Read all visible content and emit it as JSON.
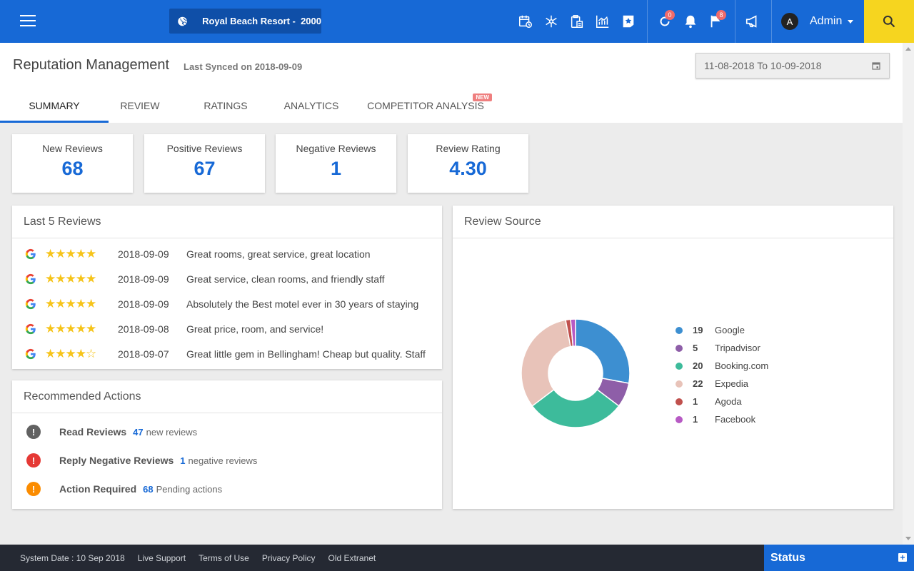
{
  "topbar": {
    "property_name": "Royal Beach Resort -  2000",
    "badges": {
      "refresh": "0",
      "flag": "8"
    },
    "admin_initial": "A",
    "admin_name": "Admin"
  },
  "header": {
    "title": "Reputation Management",
    "last_synced": "Last Synced on 2018-09-09",
    "date_range": "11-08-2018 To 10-09-2018",
    "tabs": [
      "SUMMARY",
      "REVIEW",
      "RATINGS",
      "ANALYTICS",
      "COMPETITOR ANALYSIS"
    ],
    "new_badge": "NEW"
  },
  "stats": [
    {
      "label": "New Reviews",
      "value": "68"
    },
    {
      "label": "Positive Reviews",
      "value": "67"
    },
    {
      "label": "Negative Reviews",
      "value": "1"
    },
    {
      "label": "Review Rating",
      "value": "4.30"
    }
  ],
  "last_reviews": {
    "title": "Last 5 Reviews",
    "rows": [
      {
        "stars": "★★★★★",
        "rating": 5,
        "date": "2018-09-09",
        "text": "Great rooms, great service, great location"
      },
      {
        "stars": "★★★★★",
        "rating": 5,
        "date": "2018-09-09",
        "text": "Great service, clean rooms, and friendly staff"
      },
      {
        "stars": "★★★★★",
        "rating": 5,
        "date": "2018-09-09",
        "text": "Absolutely the Best motel ever in 30 years of staying"
      },
      {
        "stars": "★★★★★",
        "rating": 5,
        "date": "2018-09-08",
        "text": "Great price, room, and service!"
      },
      {
        "stars": "★★★★☆",
        "rating": 4,
        "date": "2018-09-07",
        "text": "Great little gem in Bellingham! Cheap but quality. Staff"
      }
    ]
  },
  "actions": {
    "title": "Recommended Actions",
    "rows": [
      {
        "symbol": "!",
        "color": "#616161",
        "name": "Read Reviews",
        "count": "47",
        "desc": "new reviews"
      },
      {
        "symbol": "!",
        "color": "#e53935",
        "name": "Reply Negative Reviews",
        "count": "1",
        "desc": "negative reviews"
      },
      {
        "symbol": "!",
        "color": "#fb8c00",
        "name": "Action Required",
        "count": "68",
        "desc": "Pending actions"
      }
    ]
  },
  "review_source": {
    "title": "Review Source"
  },
  "chart_data": {
    "type": "pie",
    "donut": true,
    "categories": [
      "Google",
      "Tripadvisor",
      "Booking.com",
      "Expedia",
      "Agoda",
      "Facebook"
    ],
    "values": [
      19,
      5,
      20,
      22,
      1,
      1
    ],
    "colors": [
      "#3d8fd1",
      "#8e5ea8",
      "#3dbb9b",
      "#e8c3b9",
      "#c0504d",
      "#b75ac4"
    ],
    "legend": "right"
  },
  "footer": {
    "system_date": "System Date : 10 Sep 2018",
    "links": [
      "Live Support",
      "Terms of Use",
      "Privacy Policy",
      "Old Extranet"
    ],
    "status_label": "Status"
  }
}
